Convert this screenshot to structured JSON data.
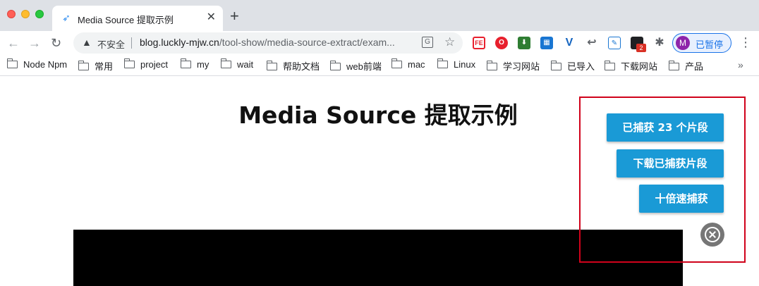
{
  "window": {
    "controls": {
      "close": "#ff5f57",
      "minimize": "#febc2e",
      "maximize": "#28c840"
    }
  },
  "tab": {
    "title": "Media Source 提取示例",
    "close_glyph": "✕",
    "favicon": "rocket-icon"
  },
  "new_tab_glyph": "+",
  "toolbar": {
    "back_glyph": "←",
    "forward_glyph": "→",
    "reload_glyph": "↻",
    "security_label": "不安全",
    "url_host": "blog.luckly-mjw.cn",
    "url_path": "/tool-show/media-source-extract/exam...",
    "star_glyph": "☆",
    "translate_glyph": "G",
    "extensions": {
      "fe": "FE",
      "opera": "O",
      "download": "⬇",
      "qr": "▦",
      "v": "V",
      "reply": "↩",
      "doc": "✎",
      "badge_count": "2",
      "puzzle": "✱"
    },
    "profile": {
      "initial": "M",
      "label": "已暂停"
    },
    "menu_glyph": "⋮"
  },
  "bookmarks": [
    "Node Npm",
    "常用",
    "project",
    "my",
    "wait",
    "帮助文档",
    "web前端",
    "mac",
    "Linux",
    "学习网站",
    "已导入",
    "下载网站",
    "产品"
  ],
  "bookmarks_more": "»",
  "page": {
    "title": "Media Source 提取示例",
    "buttons": {
      "captured": "已捕获 23 个片段",
      "download": "下载已捕获片段",
      "speed": "十倍速捕获"
    }
  },
  "colors": {
    "accent_button": "#1a9ad6",
    "highlight_border": "#d0021b",
    "close_circle": "#767676"
  }
}
